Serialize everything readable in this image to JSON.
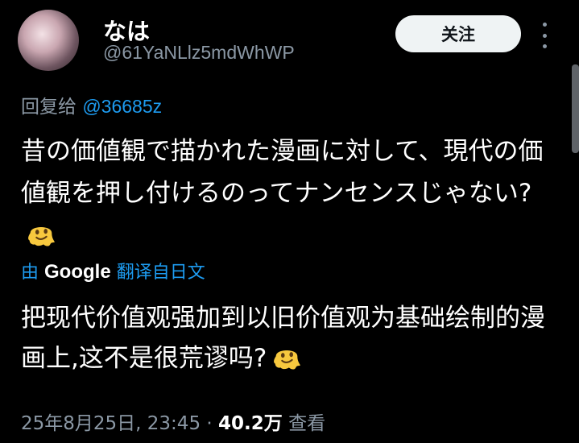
{
  "author": {
    "display_name": "なは",
    "handle": "@61YaNLlz5mdWhWP",
    "avatar_icon": "profile-avatar"
  },
  "actions": {
    "follow_label": "关注",
    "more_icon": "more-vertical-icon"
  },
  "reply": {
    "prefix": "回复给",
    "mention": "@36685z"
  },
  "tweet": {
    "text": "昔の価値観で描かれた漫画に対して、現代の価値観を押し付けるのってナンセンスじゃない?",
    "emoji_icon": "melting-face-emoji"
  },
  "translation": {
    "prefix": "由",
    "brand": "Google",
    "suffix": "翻译自日文",
    "text": "把现代价值观强加到以旧价值观为基础绘制的漫画上,这不是很荒谬吗?",
    "emoji_icon": "melting-face-emoji"
  },
  "meta": {
    "timestamp": "25年8月25日, 23:45",
    "separator": "·",
    "views_count": "40.2万",
    "views_label": "查看"
  },
  "colors": {
    "background": "#000000",
    "link": "#1d9bf0",
    "secondary_text": "#8b98a5",
    "button_bg": "#eff3f4"
  }
}
